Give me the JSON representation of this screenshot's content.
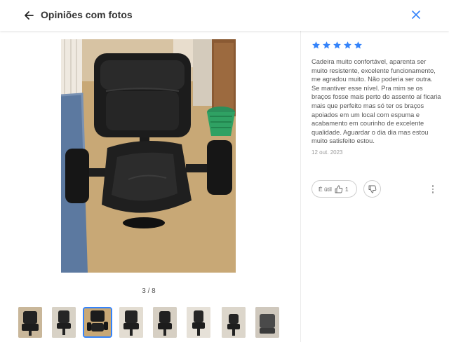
{
  "header": {
    "title": "Opiniões com fotos",
    "back_icon": "arrow-left-icon",
    "close_icon": "close-icon"
  },
  "gallery": {
    "counter": "3 / 8",
    "current_index": 3,
    "total": 8
  },
  "review": {
    "rating": 5,
    "max_rating": 5,
    "text": "Cadeira muito confortável, aparenta ser muito resistente, excelente funcionamento, me agradou muito. Não poderia ser outra. Se mantiver esse nível. Pra mim se os braços fosse mais perto do assento aí ficaria mais que perfeito mas só ter os braços apoiados em um local com espuma e acabamento em courinho de excelente qualidade. Aguardar o dia dia mas estou muito satisfeito estou.",
    "date": "12 out. 2023",
    "useful_label": "É útil",
    "useful_count": "1"
  },
  "colors": {
    "accent": "#3483fa",
    "star": "#3483fa",
    "text": "#333333",
    "muted": "#999999"
  }
}
